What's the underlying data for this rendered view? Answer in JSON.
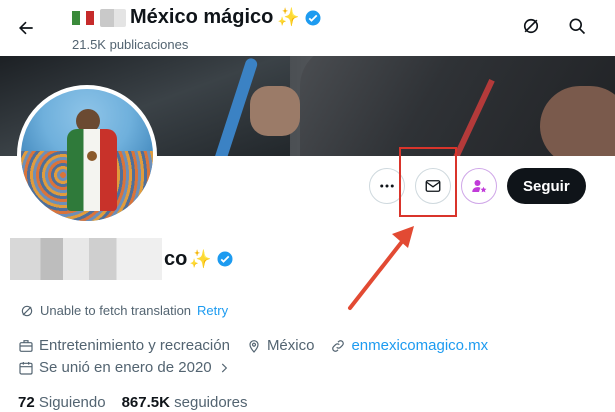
{
  "header": {
    "title": "México mágico",
    "posts_count": "21.5K publicaciones",
    "back_icon": "arrow-left-icon",
    "icons": [
      "cancel-search-icon",
      "search-icon"
    ]
  },
  "profile": {
    "display_name_suffix": "co",
    "verified": true,
    "actions": {
      "more_icon": "more-icon",
      "message_icon": "mail-icon",
      "subscribe_icon": "user-star-icon",
      "follow_label": "Seguir"
    },
    "translation": {
      "text": "Unable to fetch translation",
      "retry": "Retry"
    },
    "category": "Entretenimiento y recreación",
    "location": "México",
    "website": "enmexicomagico.mx",
    "joined": "Se unió en enero de 2020",
    "following_count": "72",
    "following_label": "Siguiendo",
    "followers_count": "867.5K",
    "followers_label": "seguidores"
  },
  "colors": {
    "accent": "#1d9bf0",
    "highlight_box": "#d9342b",
    "follow_button": "#0f1419",
    "verified": "#1d9bf0"
  }
}
